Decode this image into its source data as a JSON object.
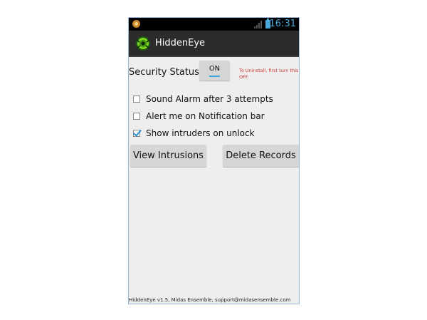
{
  "status_bar": {
    "time": "16:31",
    "notification_icon": "notification-icon",
    "signal_icon": "signal-icon",
    "battery_icon": "battery-icon",
    "accent_color": "#4aa9d8"
  },
  "action_bar": {
    "app_title": "HiddenEye",
    "app_icon": "hiddeneye-eye-icon"
  },
  "security": {
    "label": "Security Status",
    "toggle_state": "ON",
    "uninstall_note": "To Uninstall, first turn this OFF."
  },
  "options": [
    {
      "label": "Sound Alarm after 3 attempts",
      "checked": false
    },
    {
      "label": "Alert me on Notification bar",
      "checked": false
    },
    {
      "label": "Show intruders on unlock",
      "checked": true
    }
  ],
  "buttons": {
    "view_intrusions": "View Intrusions",
    "delete_records": "Delete Records"
  },
  "footer": {
    "text": "HiddenEye v1.5, Midas Ensemble, support@midasensemble.com"
  }
}
